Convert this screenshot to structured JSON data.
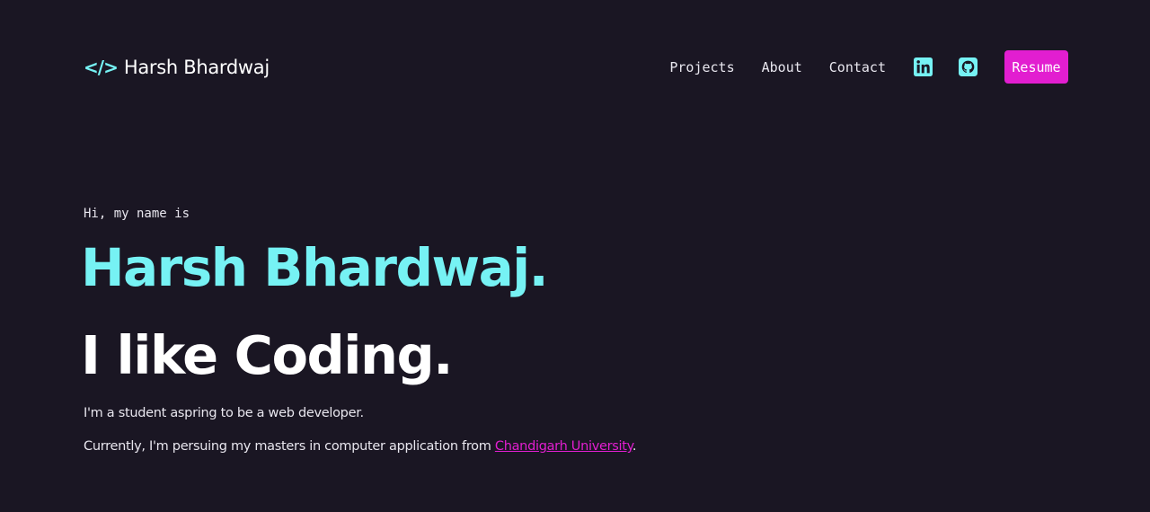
{
  "header": {
    "logo_icon": "</>",
    "logo_text": "Harsh Bhardwaj",
    "nav": {
      "projects": "Projects",
      "about": "About",
      "contact": "Contact"
    },
    "social": {
      "linkedin_icon": "linkedin-icon",
      "github_icon": "github-icon"
    },
    "resume_label": "Resume"
  },
  "hero": {
    "greeting": "Hi, my name is",
    "name": "Harsh Bhardwaj.",
    "tagline": "I like Coding.",
    "bio_line1": "I'm a student aspring to be a web developer.",
    "bio_line2_prefix": "Currently, I'm persuing my masters in computer application from ",
    "bio_line2_link": "Chandigarh University",
    "bio_line2_suffix": "."
  },
  "colors": {
    "background": "#1a1623",
    "accent_cyan": "#76f2f4",
    "accent_magenta": "#e21ed0",
    "text": "#e8e6ee"
  }
}
